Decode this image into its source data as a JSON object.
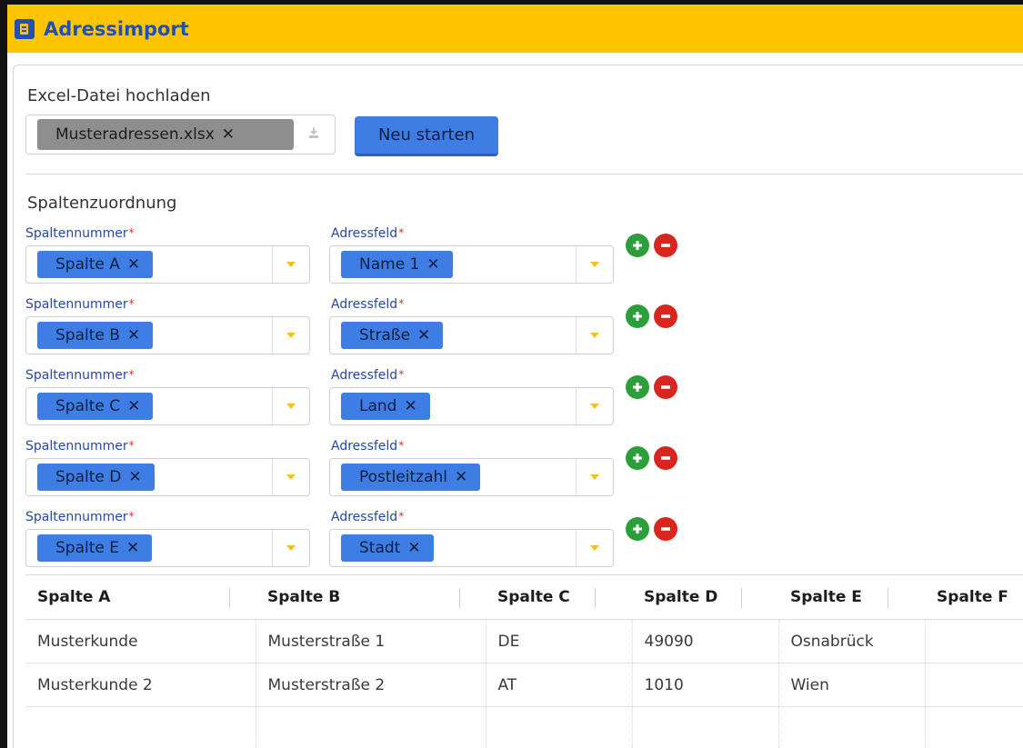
{
  "app": {
    "title": "Adressimport",
    "icon": "app-logo-icon"
  },
  "upload": {
    "label": "Excel-Datei hochladen",
    "file_name": "Musteradressen.xlsx",
    "remove_glyph": "✕",
    "upload_icon": "upload-icon",
    "restart_label": "Neu starten"
  },
  "mapping": {
    "title": "Spaltenzuordnung",
    "column_label": "Spaltennummer",
    "field_label": "Adressfeld",
    "required_mark": "*",
    "rows": [
      {
        "column": "Spalte A",
        "field": "Name 1"
      },
      {
        "column": "Spalte B",
        "field": "Straße"
      },
      {
        "column": "Spalte C",
        "field": "Land"
      },
      {
        "column": "Spalte D",
        "field": "Postleitzahl"
      },
      {
        "column": "Spalte E",
        "field": "Stadt"
      }
    ]
  },
  "preview": {
    "headers": [
      "Spalte A",
      "Spalte B",
      "Spalte C",
      "Spalte D",
      "Spalte E",
      "Spalte F"
    ],
    "rows": [
      [
        "Musterkunde",
        "Musterstraße 1",
        "DE",
        "49090",
        "Osnabrück",
        ""
      ],
      [
        "Musterkunde 2",
        "Musterstraße 2",
        "AT",
        "1010",
        "Wien",
        ""
      ],
      [
        "",
        "",
        "",
        "",
        "",
        ""
      ]
    ]
  },
  "colors": {
    "titlebar": "#ffc600",
    "title_text": "#2151b5",
    "tag": "#3d7de4",
    "add": "#2d9e3c",
    "remove": "#d8261e",
    "caret": "#f3c11b"
  }
}
